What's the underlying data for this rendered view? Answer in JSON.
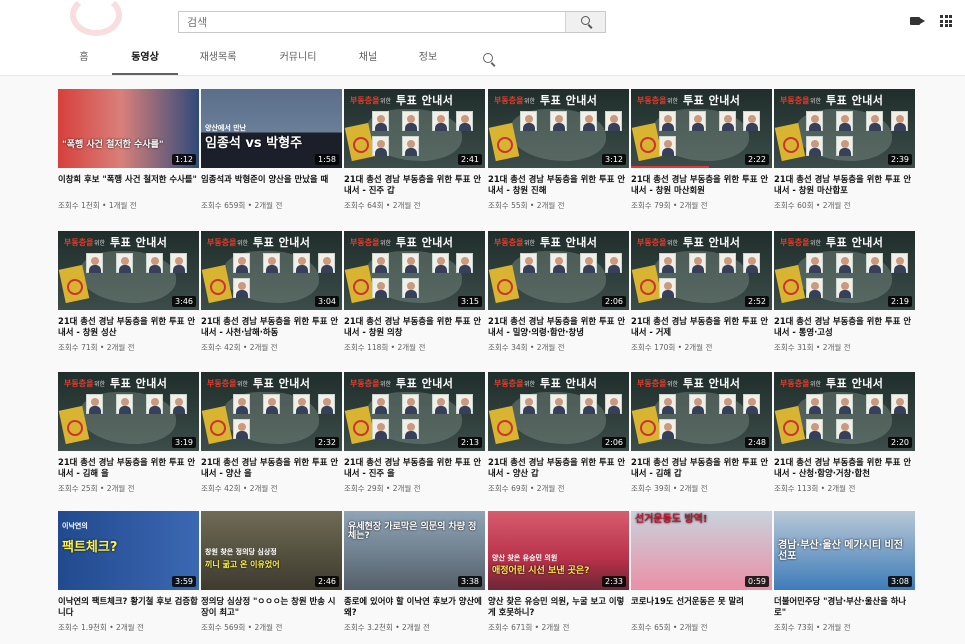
{
  "search": {
    "placeholder": "검색"
  },
  "tabs": [
    {
      "label": "홈",
      "active": false
    },
    {
      "label": "동영상",
      "active": true
    },
    {
      "label": "재생목록",
      "active": false
    },
    {
      "label": "커뮤니티",
      "active": false
    },
    {
      "label": "채널",
      "active": false
    },
    {
      "label": "정보",
      "active": false
    }
  ],
  "ballot_banner": {
    "red": "부동층을",
    "small": "위한",
    "title": "투표 안내서"
  },
  "colors": {
    "accent": "#e53935",
    "muted": "#606060",
    "bg": "#f9f9f9"
  },
  "videos": [
    {
      "title": "이창희 후보 \"폭행 사건 철저한 수사를\"",
      "meta": "조회수 1천회 • 1개월 전",
      "duration": "1:12",
      "thumb_caption": "\"폭행 사건 철저한 수사를\""
    },
    {
      "title": "임종석과 박형준이 양산을 만났을 때",
      "meta": "조회수 659회 • 2개월 전",
      "duration": "1:58",
      "thumb_caption": "임종석 vs 박형주",
      "thumb_sub": "양산에서 만난"
    },
    {
      "title": "21대 총선 경남 부동층을 위한 투표 안내서 - 진주 갑",
      "meta": "조회수 64회 • 2개월 전",
      "duration": "2:41"
    },
    {
      "title": "21대 총선 경남 부동층을 위한 투표 안내서 - 창원 진해",
      "meta": "조회수 55회 • 2개월 전",
      "duration": "3:12"
    },
    {
      "title": "21대 총선 경남 부동층을 위한 투표 안내서 - 창원 마산회원",
      "meta": "조회수 79회 • 2개월 전",
      "duration": "2:22"
    },
    {
      "title": "21대 총선 경남 부동층을 위한 투표 안내서 - 창원 마산합포",
      "meta": "조회수 60회 • 2개월 전",
      "duration": "2:39"
    },
    {
      "title": "21대 총선 경남 부동층을 위한 투표 안내서 - 창원 성산",
      "meta": "조회수 71회 • 2개월 전",
      "duration": "3:46"
    },
    {
      "title": "21대 총선 경남 부동층을 위한 투표 안내서 - 사천·남해·하동",
      "meta": "조회수 42회 • 2개월 전",
      "duration": "3:04"
    },
    {
      "title": "21대 총선 경남 부동층을 위한 투표 안내서 - 창원 의창",
      "meta": "조회수 118회 • 2개월 전",
      "duration": "3:15"
    },
    {
      "title": "21대 총선 경남 부동층을 위한 투표 안내서 - 밀양·의령·함안·창녕",
      "meta": "조회수 34회 • 2개월 전",
      "duration": "2:06"
    },
    {
      "title": "21대 총선 경남 부동층을 위한 투표 안내서 - 거제",
      "meta": "조회수 170회 • 2개월 전",
      "duration": "2:52"
    },
    {
      "title": "21대 총선 경남 부동층을 위한 투표 안내서 - 통영·고성",
      "meta": "조회수 31회 • 2개월 전",
      "duration": "2:19"
    },
    {
      "title": "21대 총선 경남 부동층을 위한 투표 안내서 - 김해 을",
      "meta": "조회수 25회 • 2개월 전",
      "duration": "3:19"
    },
    {
      "title": "21대 총선 경남 부동층을 위한 투표 안내서 - 양산 을",
      "meta": "조회수 42회 • 2개월 전",
      "duration": "2:32"
    },
    {
      "title": "21대 총선 경남 부동층을 위한 투표 안내서 - 진주 을",
      "meta": "조회수 29회 • 2개월 전",
      "duration": "2:13"
    },
    {
      "title": "21대 총선 경남 부동층을 위한 투표 안내서 - 양산 갑",
      "meta": "조회수 69회 • 2개월 전",
      "duration": "2:06"
    },
    {
      "title": "21대 총선 경남 부동층을 위한 투표 안내서 - 김해 갑",
      "meta": "조회수 39회 • 2개월 전",
      "duration": "2:48"
    },
    {
      "title": "21대 총선 경남 부동층을 위한 투표 안내서 - 산청·함양·거창·합천",
      "meta": "조회수 113회 • 2개월 전",
      "duration": "2:20"
    },
    {
      "title": "이낙연의 팩트체크? 황기철 후보 검증합니다",
      "meta": "조회수 1.9천회 • 2개월 전",
      "duration": "3:59",
      "thumb_caption": "팩트체크?",
      "thumb_sub": "이낙연의"
    },
    {
      "title": "정의당 심상정 \"ㅇㅇㅇ는 창원 반송 시장이 최고\"",
      "meta": "조회수 569회 • 2개월 전",
      "duration": "2:46",
      "thumb_caption": "끼니 굶고 온 이유었어",
      "thumb_sub": "창원 찾은 정의당 심상정"
    },
    {
      "title": "종로에 있어야 할 이낙연 후보가 양산에 왜?",
      "meta": "조회수 3.2천회 • 2개월 전",
      "duration": "3:38",
      "thumb_caption": "유세현장 가로막은 의문의 차량 정체는?"
    },
    {
      "title": "양산 찾은 유승민 의원, 누굴 보고 이렇게 호못하니?",
      "meta": "조회수 671회 • 2개월 전",
      "duration": "2:33",
      "thumb_caption": "애정어린 시선 보낸 곳은?",
      "thumb_sub": "양산 찾은 유승민 의원"
    },
    {
      "title": "코로나19도 선거운동은 못 말려",
      "meta": "조회수 65회 • 2개월 전",
      "duration": "0:59",
      "thumb_caption": "선거운동도 방역!"
    },
    {
      "title": "더불어민주당 \"경남·부산·울산을 하나로\"",
      "meta": "조회수 73회 • 2개월 전",
      "duration": "3:08",
      "thumb_caption": "경남·부산·울산 메가시티 비전 선포"
    }
  ]
}
